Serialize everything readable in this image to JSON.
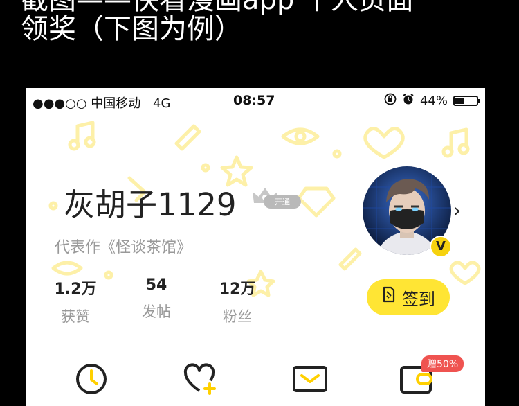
{
  "caption": {
    "line1": "截图——快看漫画app 个人页面",
    "line2": "领奖（下图为例）"
  },
  "status_bar": {
    "carrier": "●●●○○ 中国移动",
    "network": "4G",
    "time": "08:57",
    "battery": "44%",
    "battery_level": 0.44
  },
  "profile": {
    "username": "灰胡子1129",
    "vip_badge": "开通",
    "masterpiece": "代表作《怪谈茶馆》",
    "verified_badge": "V",
    "stats": [
      {
        "value": "1.2万",
        "label": "获赞"
      },
      {
        "value": "54",
        "label": "发帖"
      },
      {
        "value": "12万",
        "label": "粉丝"
      }
    ],
    "signin_label": "签到"
  },
  "menu": {
    "promo_badge": "赠50%",
    "icons": [
      "history-icon",
      "follow-icon",
      "message-icon",
      "wallet-icon"
    ]
  },
  "colors": {
    "accent_yellow": "#ffe534",
    "badge_red": "#ef5350",
    "muted_text": "#999999"
  }
}
